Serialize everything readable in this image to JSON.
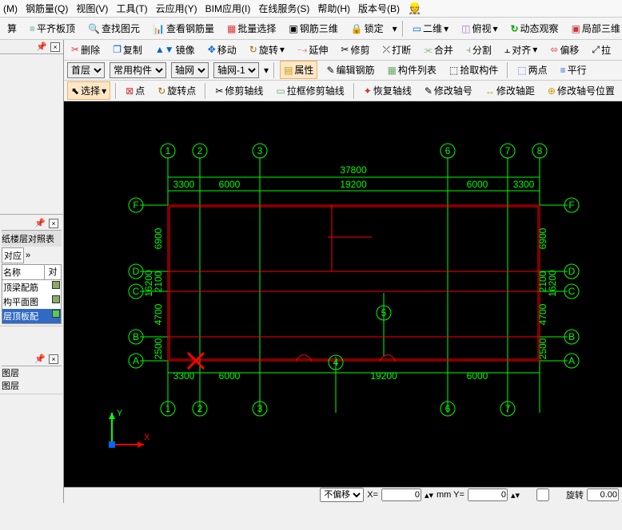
{
  "menu": {
    "items": [
      "(M)",
      "钢筋量(Q)",
      "视图(V)",
      "工具(T)",
      "云应用(Y)",
      "BIM应用(I)",
      "在线服务(S)",
      "帮助(H)",
      "版本号(B)"
    ]
  },
  "toolbar1": {
    "calc": "算",
    "level_top": "平齐板顶",
    "find_element": "查找图元",
    "view_rebar": "查看钢筋量",
    "batch_select": "批量选择",
    "rebar_3d": "钢筋三维",
    "lock": "锁定",
    "view2d": "二维",
    "ortho": "俯视",
    "dynamic_view": "动态观察",
    "local_3d": "局部三维"
  },
  "toolbar2": {
    "delete": "删除",
    "copy": "复制",
    "mirror": "镜像",
    "move": "移动",
    "rotate": "旋转",
    "extend": "延伸",
    "trim": "修剪",
    "break": "打断",
    "join": "合并",
    "split": "分割",
    "align": "对齐",
    "offset": "偏移",
    "la": "拉"
  },
  "toolbar3": {
    "floor": "首层",
    "component": "常用构件",
    "axis_cat": "轴网",
    "axis_item": "轴网-1",
    "properties": "属性",
    "edit_rebar": "编辑钢筋",
    "component_list": "构件列表",
    "pick_component": "拾取构件",
    "two_points": "两点",
    "parallel": "平行"
  },
  "toolbar4": {
    "select": "选择",
    "point": "点",
    "rotate_point": "旋转点",
    "trim_axis": "修剪轴线",
    "frame_trim": "拉框修剪轴线",
    "restore_axis": "恢复轴线",
    "modify_num": "修改轴号",
    "modify_dist": "修改轴距",
    "modify_pos": "修改轴号位置"
  },
  "leftpanel": {
    "title": "纸楼层对照表",
    "corresp": "对应",
    "name": "名称",
    "items": [
      "顶梁配筋",
      "构平面图",
      "层顶板配"
    ],
    "pin_label": "图层",
    "pin_label2": "图层"
  },
  "statusbar": {
    "offset_mode": "不偏移",
    "x_label": "X=",
    "x_value": "0",
    "y_label": "mm Y=",
    "y_value": "0",
    "rotate_label": "旋转",
    "rotate_value": "0.00"
  },
  "chart_data": {
    "type": "cad-axis-grid",
    "horizontal_axes": [
      "A",
      "B",
      "C",
      "D",
      "F"
    ],
    "vertical_axes": [
      "1",
      "2",
      "3",
      "4",
      "5",
      "6",
      "7",
      "8"
    ],
    "h_dimensions_top": [
      "3300",
      "6000",
      "19200",
      "6000",
      "3300"
    ],
    "h_dimensions_bottom": [
      "3300",
      "6000",
      "19200",
      "6000"
    ],
    "total_width": "37800",
    "v_dimensions_left": [
      "2500",
      "4700",
      "2100",
      "6900"
    ],
    "v_total_left": "16200",
    "v_dimensions_right": [
      "2500",
      "4700",
      "2100",
      "6900"
    ],
    "v_total_right": "16200",
    "origin_marker": "X",
    "ucs": {
      "x_axis": "X",
      "y_axis": "Y"
    }
  }
}
